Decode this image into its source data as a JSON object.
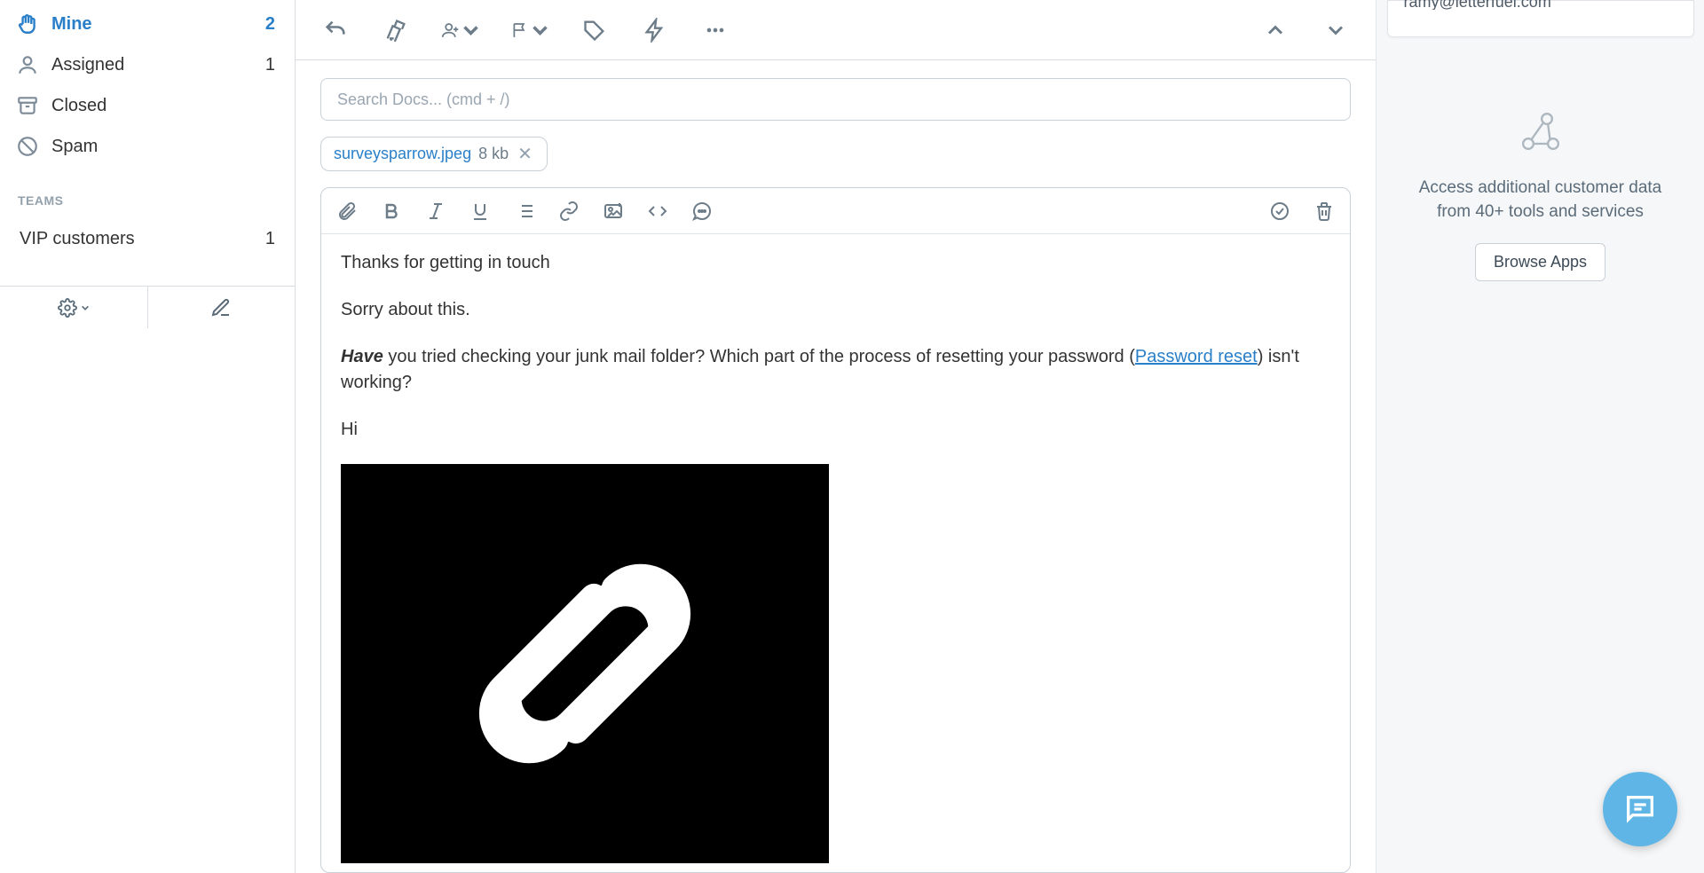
{
  "sidebar": {
    "items": [
      {
        "label": "Mine",
        "count": "2",
        "icon": "hand"
      },
      {
        "label": "Assigned",
        "count": "1",
        "icon": "user"
      },
      {
        "label": "Closed",
        "count": "",
        "icon": "archive"
      },
      {
        "label": "Spam",
        "count": "",
        "icon": "block"
      }
    ],
    "teams_heading": "TEAMS",
    "teams": [
      {
        "label": "VIP customers",
        "count": "1"
      }
    ]
  },
  "convo_toolbar": {
    "icons": [
      "undo",
      "clean",
      "assign",
      "status",
      "tag",
      "workflow",
      "more"
    ],
    "nav_icons": [
      "chevron-up",
      "chevron-down"
    ]
  },
  "compose": {
    "search_placeholder": "Search Docs... (cmd + /)",
    "attachment": {
      "name": "surveysparrow.jpeg",
      "size": "8 kb"
    },
    "editor_toolbar_left": [
      "attach",
      "bold",
      "italic",
      "underline",
      "list",
      "link",
      "image",
      "code",
      "quote"
    ],
    "editor_toolbar_right": [
      "check-circle",
      "trash"
    ],
    "body": {
      "p1": "Thanks for getting in touch",
      "p2": "Sorry about this.",
      "p3_bold": "Have",
      "p3_a": " you tried checking your junk mail folder? Which part of the process of resetting your password (",
      "p3_link": "Password reset",
      "p3_b": ") isn't working?",
      "p4": "Hi"
    }
  },
  "right_panel": {
    "customer_email": "ramy@letterfuel.com",
    "promo_text": "Access additional customer data from 40+ tools and services",
    "browse_label": "Browse Apps"
  }
}
